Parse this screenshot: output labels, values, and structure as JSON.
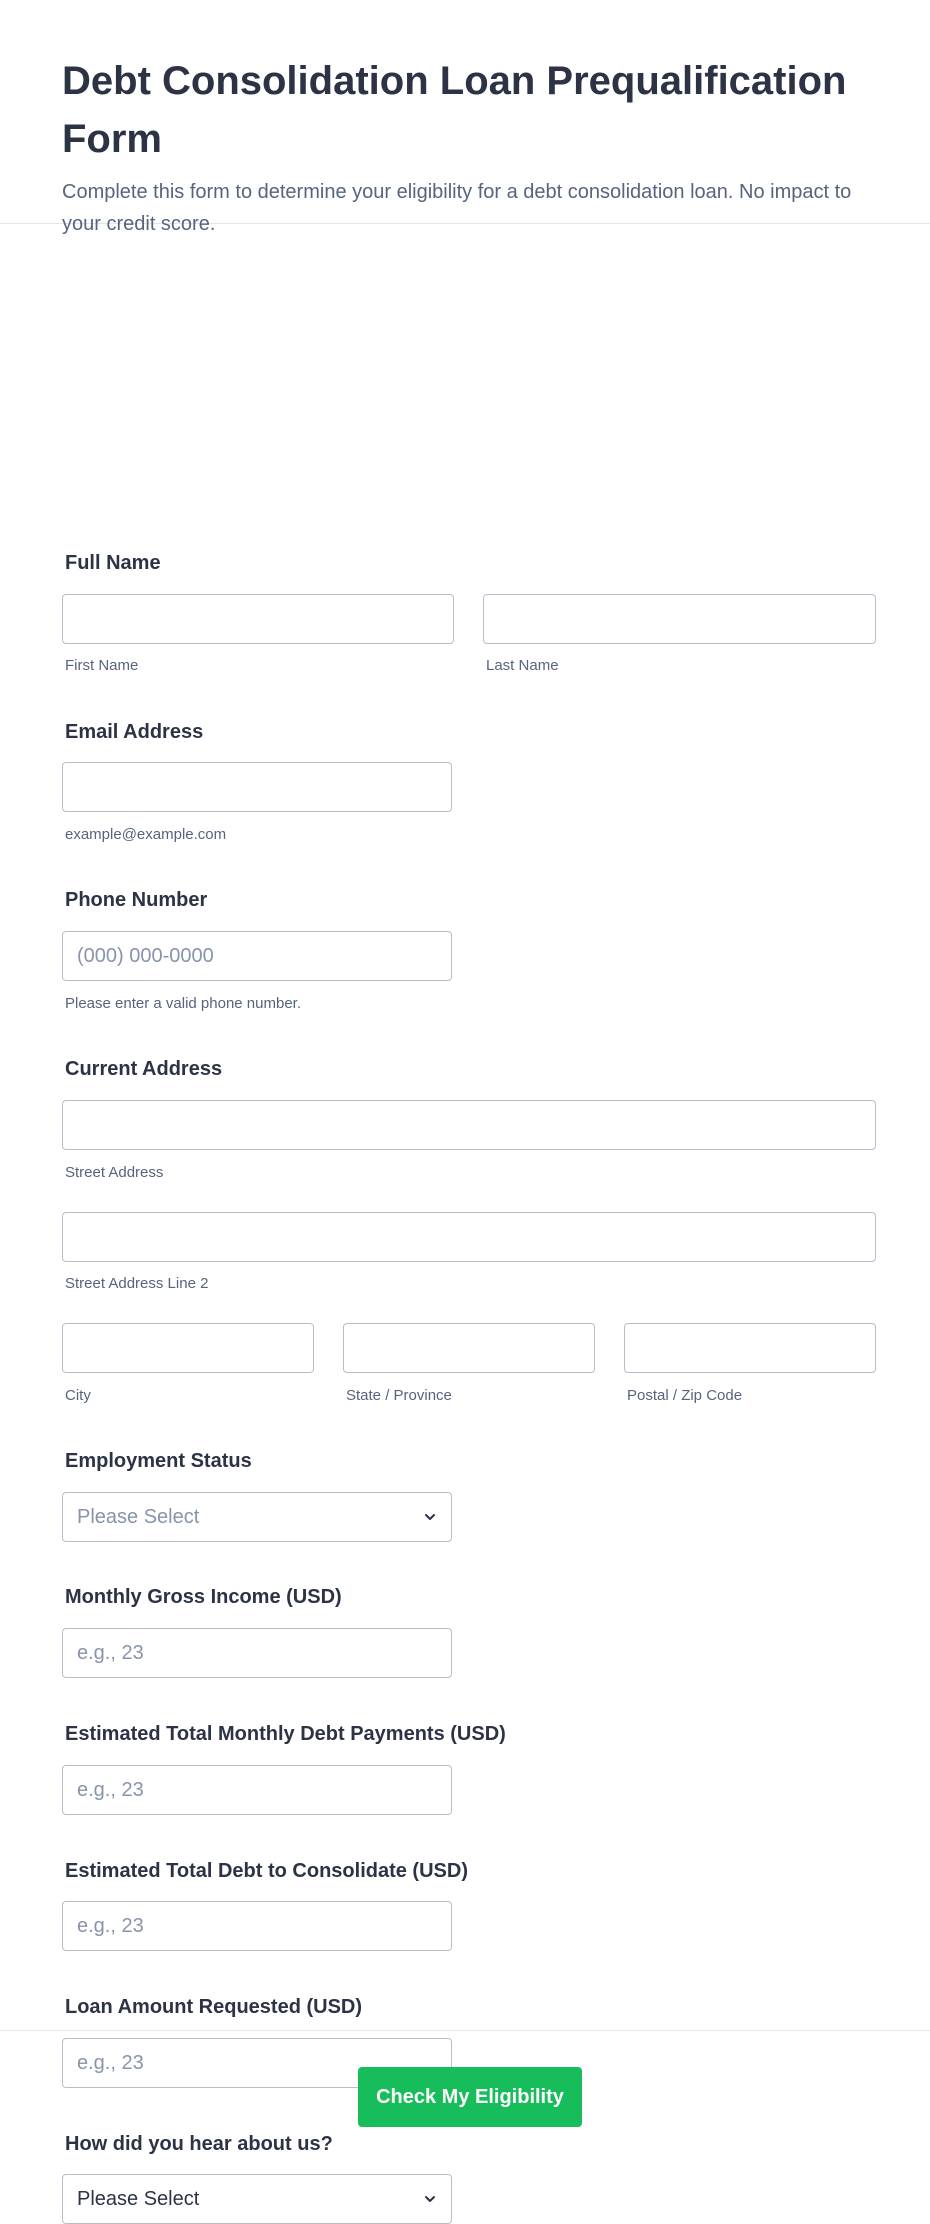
{
  "header": {
    "title": "Debt Consolidation Loan Prequalification Form",
    "subtitle": "Complete this form to determine your eligibility for a debt consolidation loan. No impact to your credit score."
  },
  "fields": {
    "full_name": {
      "label": "Full Name",
      "first_sub": "First Name",
      "last_sub": "Last Name",
      "first_value": "",
      "last_value": ""
    },
    "email": {
      "label": "Email Address",
      "sub": "example@example.com",
      "value": ""
    },
    "phone": {
      "label": "Phone Number",
      "placeholder": "(000) 000-0000",
      "sub": "Please enter a valid phone number.",
      "value": ""
    },
    "address": {
      "label": "Current Address",
      "street_sub": "Street Address",
      "street2_sub": "Street Address Line 2",
      "city_sub": "City",
      "state_sub": "State / Province",
      "zip_sub": "Postal / Zip Code"
    },
    "employment": {
      "label": "Employment Status",
      "selected": "Please Select"
    },
    "monthly_income": {
      "label": "Monthly Gross Income (USD)",
      "placeholder": "e.g., 23"
    },
    "monthly_debt": {
      "label": "Estimated Total Monthly Debt Payments (USD)",
      "placeholder": "e.g., 23"
    },
    "total_debt": {
      "label": "Estimated Total Debt to Consolidate (USD)",
      "placeholder": "e.g., 23"
    },
    "loan_amount": {
      "label": "Loan Amount Requested (USD)",
      "placeholder": "e.g., 23"
    },
    "referral": {
      "label": "How did you hear about us?",
      "selected": "Please Select"
    }
  },
  "submit_label": "Check My Eligibility",
  "colors": {
    "accent": "#18bd5b",
    "border": "#b8bdc9",
    "text": "#2c3345",
    "muted": "#57647e",
    "placeholder": "#8894ab"
  }
}
